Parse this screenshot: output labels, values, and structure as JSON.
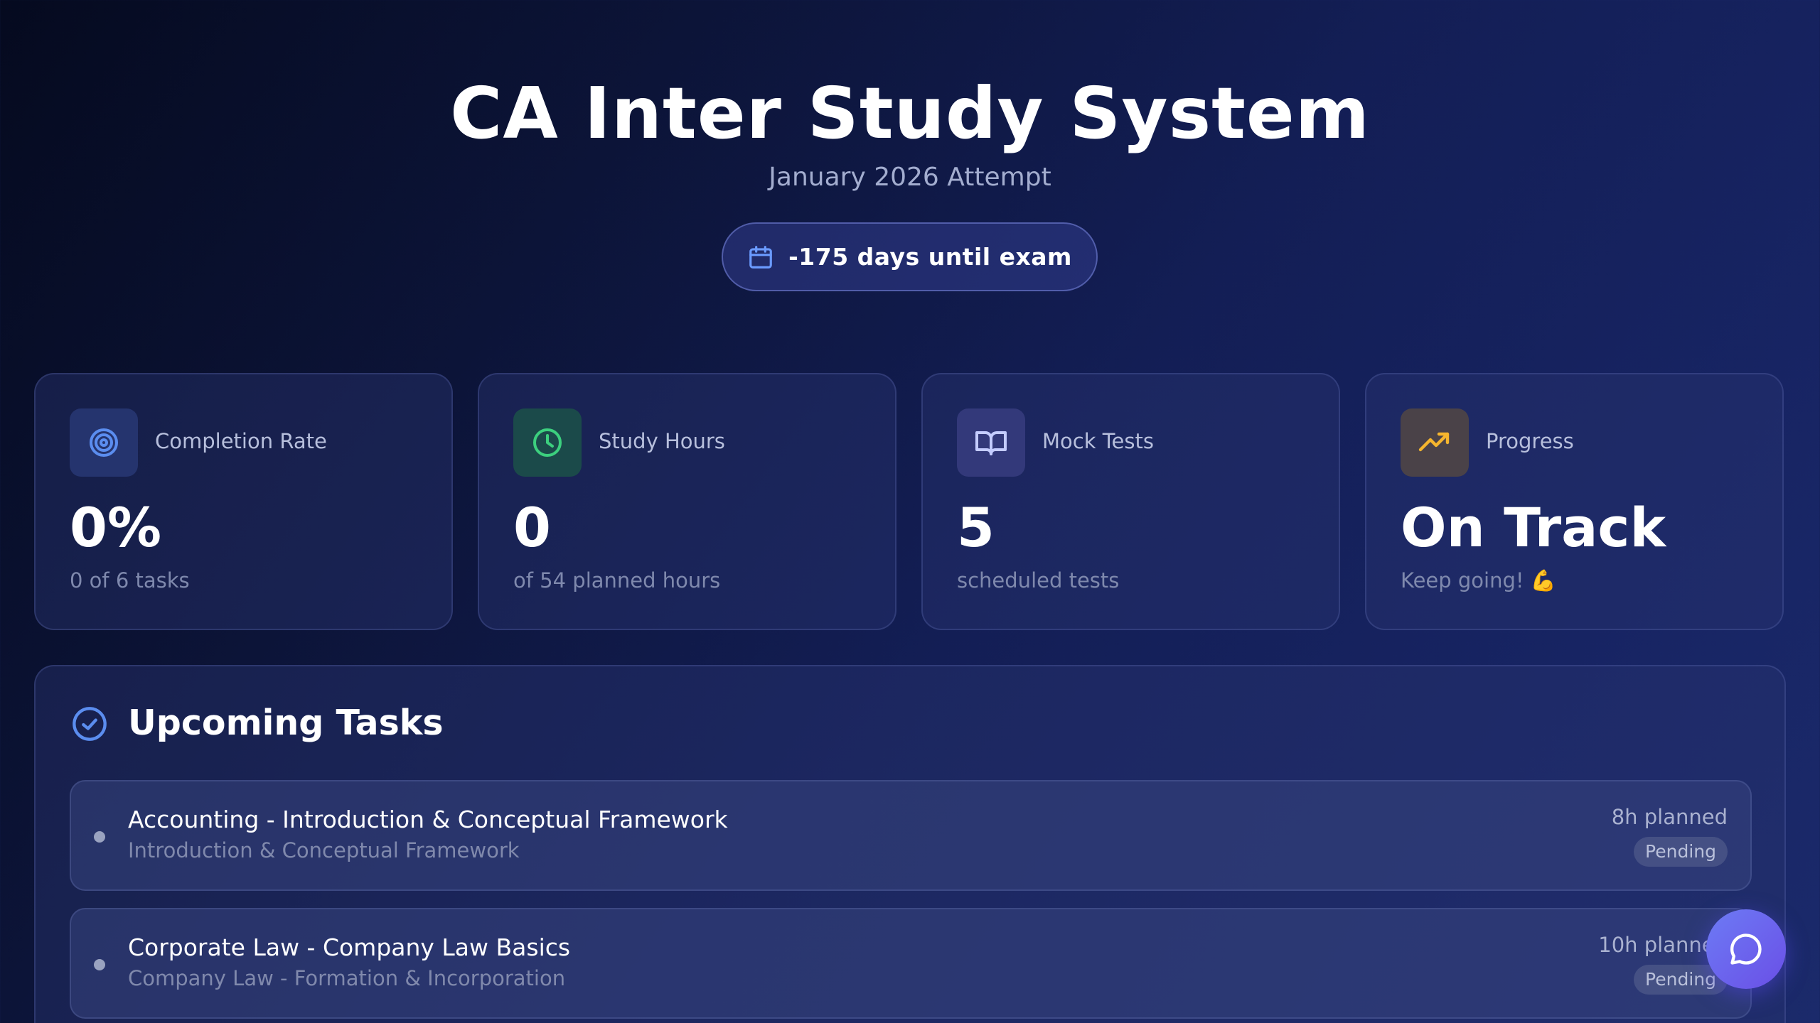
{
  "header": {
    "title": "CA Inter Study System",
    "subtitle": "January 2026 Attempt",
    "countdown": {
      "icon": "calendar-icon",
      "text": "-175 days until exam"
    }
  },
  "stats": [
    {
      "label": "Completion Rate",
      "value": "0%",
      "sub": "0 of 6 tasks",
      "icon": "target-icon",
      "accent": "#5b8def"
    },
    {
      "label": "Study Hours",
      "value": "0",
      "sub": "of 54 planned hours",
      "icon": "clock-icon",
      "accent": "#3ccf7e"
    },
    {
      "label": "Mock Tests",
      "value": "5",
      "sub": "scheduled tests",
      "icon": "book-open-icon",
      "accent": "#b9c3ff"
    },
    {
      "label": "Progress",
      "value": "On Track",
      "sub": "Keep going! 💪",
      "icon": "trending-up-icon",
      "accent": "#f5b52e"
    }
  ],
  "tasks": {
    "title": "Upcoming Tasks",
    "icon": "check-circle-icon",
    "items": [
      {
        "title": "Accounting - Introduction & Conceptual Framework",
        "subtitle": "Introduction & Conceptual Framework",
        "hours": "8h planned",
        "status": "Pending"
      },
      {
        "title": "Corporate Law - Company Law Basics",
        "subtitle": "Company Law - Formation & Incorporation",
        "hours": "10h planned",
        "status": "Pending"
      }
    ]
  },
  "chat": {
    "icon": "chat-bubble-icon"
  }
}
